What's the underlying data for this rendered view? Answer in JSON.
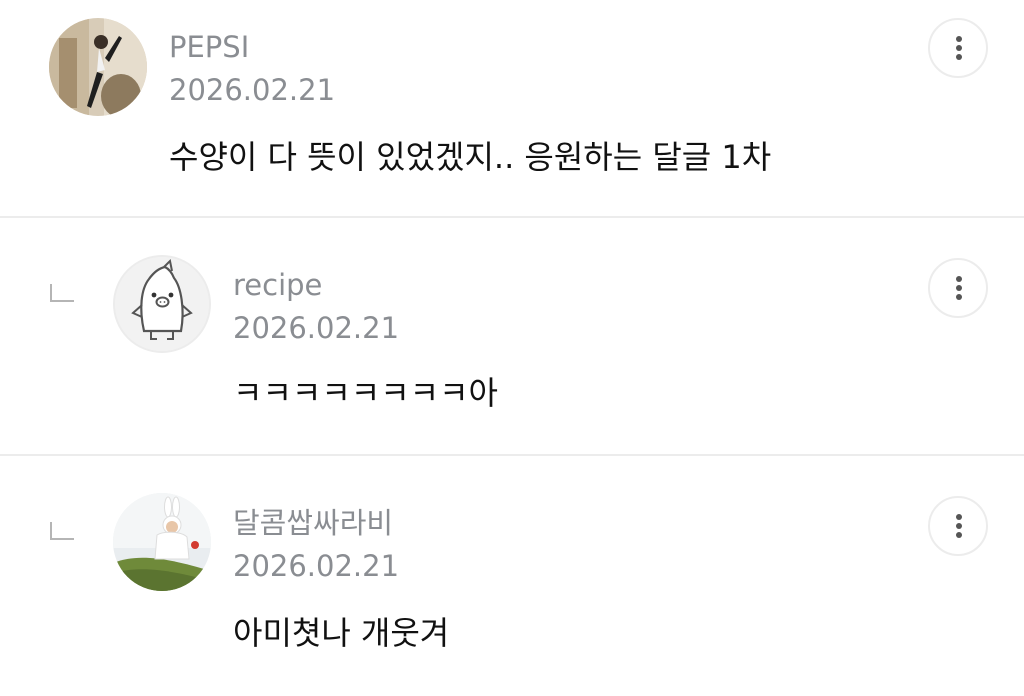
{
  "comments": [
    {
      "author": "PEPSI",
      "date": "2026.02.21",
      "text": "수양이 다 뜻이 있었겠지.. 응원하는 달글 1차",
      "is_reply": false,
      "avatar_icon": "photo-avatar-dancer"
    },
    {
      "author": "recipe",
      "date": "2026.02.21",
      "text": "ㅋㅋㅋㅋㅋㅋㅋㅋ아",
      "is_reply": true,
      "avatar_icon": "penguin-mascot-avatar"
    },
    {
      "author": "달콤쌉싸라비",
      "date": "2026.02.21",
      "text": "아미쳣나 개웃겨",
      "is_reply": true,
      "avatar_icon": "photo-avatar-bunny-costume"
    }
  ],
  "more_button_icon": "vertical-ellipsis-icon",
  "colors": {
    "meta_text": "#8a8d92",
    "body_text": "#111111",
    "divider": "#ececec"
  }
}
